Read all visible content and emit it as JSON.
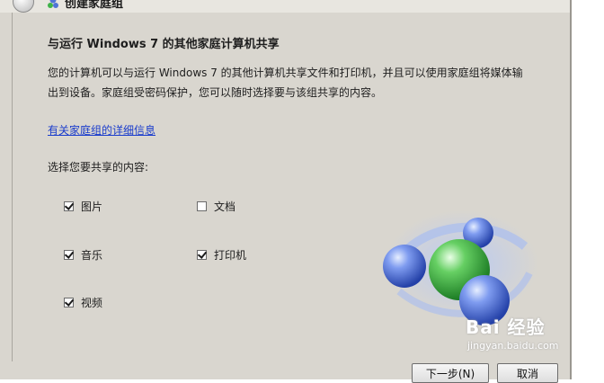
{
  "window": {
    "title": "创建家庭组"
  },
  "main": {
    "heading": "与运行 Windows 7 的其他家庭计算机共享",
    "description": "您的计算机可以与运行 Windows 7 的其他计算机共享文件和打印机，并且可以使用家庭组将媒体输出到设备。家庭组受密码保护，您可以随时选择要与该组共享的内容。",
    "details_link": "有关家庭组的详细信息",
    "choose_label": "选择您要共享的内容:"
  },
  "options": {
    "pictures": {
      "label": "图片",
      "checked": true
    },
    "documents": {
      "label": "文档",
      "checked": false
    },
    "music": {
      "label": "音乐",
      "checked": true
    },
    "printers": {
      "label": "打印机",
      "checked": true
    },
    "videos": {
      "label": "视频",
      "checked": true
    }
  },
  "buttons": {
    "next": "下一步(N)",
    "cancel": "取消"
  },
  "watermark": {
    "brand": "Bai 经验",
    "url": "jingyan.baidu.com"
  },
  "colors": {
    "link": "#1a3ccc",
    "dialog_bg": "#d9d6cf",
    "sphere_blue": "#4f74d6",
    "sphere_green": "#3fb24a"
  }
}
